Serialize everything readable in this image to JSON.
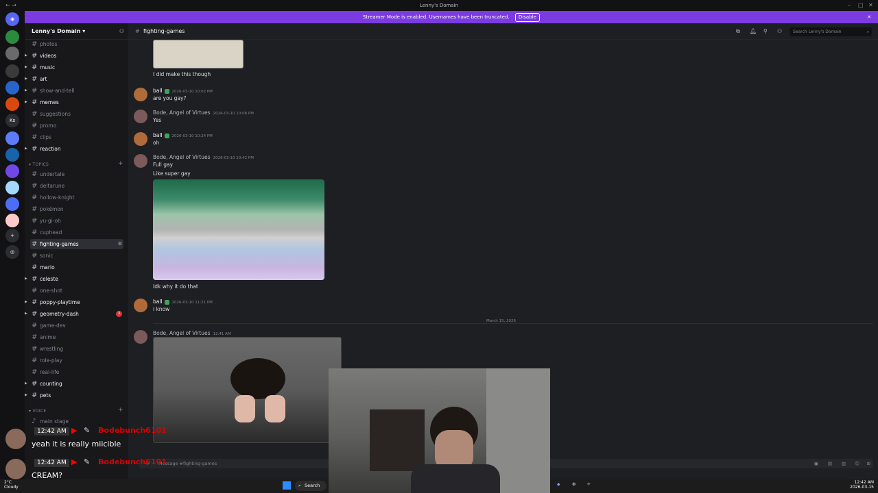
{
  "window": {
    "title": "Lenny's Domain"
  },
  "banner": {
    "text": "Streamer Mode is enabled. Usernames have been truncated.",
    "button": "Disable"
  },
  "server": {
    "name": "Lenny's Domain"
  },
  "channels": [
    {
      "name": "photos",
      "bold": false,
      "caret": false
    },
    {
      "name": "videos",
      "bold": true,
      "caret": true
    },
    {
      "name": "music",
      "bold": true,
      "caret": true
    },
    {
      "name": "art",
      "bold": true,
      "caret": true
    },
    {
      "name": "show-and-tell",
      "bold": false,
      "caret": true
    },
    {
      "name": "memes",
      "bold": true,
      "caret": true
    },
    {
      "name": "suggestions",
      "bold": false,
      "caret": false
    },
    {
      "name": "promo",
      "bold": false,
      "caret": false
    },
    {
      "name": "clips",
      "bold": false,
      "caret": false
    },
    {
      "name": "reaction",
      "bold": true,
      "caret": true
    }
  ],
  "topics_label": "TOPICS",
  "topic_channels": [
    {
      "name": "undertale",
      "bold": false,
      "caret": false
    },
    {
      "name": "deltarune",
      "bold": false,
      "caret": false
    },
    {
      "name": "hollow-knight",
      "bold": false,
      "caret": false
    },
    {
      "name": "pokémon",
      "bold": false,
      "caret": false
    },
    {
      "name": "yu-gi-oh",
      "bold": false,
      "caret": false
    },
    {
      "name": "cuphead",
      "bold": false,
      "caret": false
    },
    {
      "name": "fighting-games",
      "bold": true,
      "caret": false,
      "selected": true
    },
    {
      "name": "sonic",
      "bold": false,
      "caret": false
    },
    {
      "name": "mario",
      "bold": true,
      "caret": false
    },
    {
      "name": "celeste",
      "bold": true,
      "caret": true
    },
    {
      "name": "one-shot",
      "bold": false,
      "caret": false
    },
    {
      "name": "poppy-playtime",
      "bold": true,
      "caret": true
    },
    {
      "name": "geometry-dash",
      "bold": true,
      "caret": true,
      "badge": "3"
    },
    {
      "name": "game-dev",
      "bold": false,
      "caret": false
    },
    {
      "name": "anime",
      "bold": false,
      "caret": false
    },
    {
      "name": "wrestling",
      "bold": false,
      "caret": false
    },
    {
      "name": "role-play",
      "bold": false,
      "caret": false
    },
    {
      "name": "real-life",
      "bold": false,
      "caret": false
    },
    {
      "name": "counting",
      "bold": true,
      "caret": true
    },
    {
      "name": "pets",
      "bold": true,
      "caret": true
    }
  ],
  "voice_label": "VOICE",
  "voice_channel": "main stage",
  "header": {
    "channel": "fighting-games",
    "search_placeholder": "Search Lenny's Domain"
  },
  "messages": [
    {
      "text": "I did make this though"
    },
    {
      "user": "ball",
      "time": "2026-03-10 10:02 PM",
      "text": "are you gay?"
    },
    {
      "user": "Bode, Angel of Virtues",
      "time": "2026-03-10 10:08 PM",
      "text": "Yes"
    },
    {
      "user": "ball",
      "time": "2026-03-10 10:24 PM",
      "text": "oh"
    },
    {
      "user": "Bode, Angel of Virtues",
      "time": "2026-03-10 10:42 PM",
      "text": "Full gay",
      "text2": "Like super gay"
    },
    {
      "text": "Idk why it do that"
    },
    {
      "user": "ball",
      "time": "2026-03-10 11:21 PM",
      "text": "i know"
    },
    {
      "user": "Bode, Angel of Virtues",
      "time": "12:41 AM"
    }
  ],
  "date_divider": "March 15, 2026",
  "composer_placeholder": "Message #fighting-games",
  "stream_chat": [
    {
      "time": "12:42 AM",
      "user": "Bodebunch6101",
      "text": "yeah it is really miicible"
    },
    {
      "time": "12:42 AM",
      "user": "Bodebunch6101",
      "text": "CREAM?"
    }
  ],
  "taskbar": {
    "weather_temp": "2°C",
    "weather": "Cloudy",
    "search": "Search",
    "time": "12:42 AM",
    "date": "2026-03-15"
  }
}
